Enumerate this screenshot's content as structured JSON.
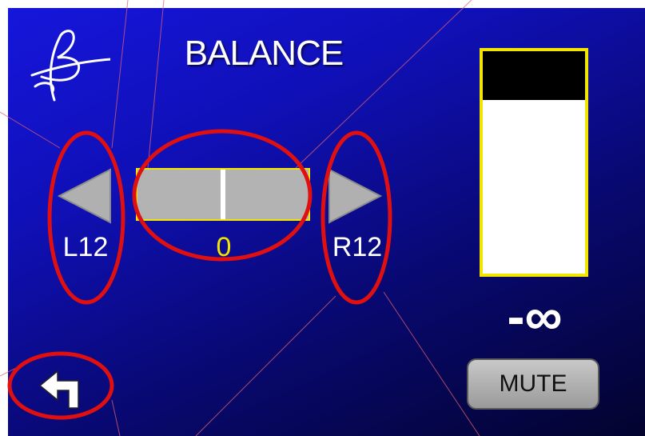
{
  "screen": {
    "title": "BALANCE"
  },
  "balance": {
    "value": "0",
    "left_label": "L12",
    "right_label": "R12",
    "position": 0.5
  },
  "level_meter": {
    "value": "-∞",
    "fill_fraction": 0.22
  },
  "buttons": {
    "mute_label": "MUTE",
    "left_arrow_icon": "left-triangle-icon",
    "right_arrow_icon": "right-triangle-icon",
    "back_icon": "back-arrow-icon"
  },
  "colors": {
    "accent": "#f2e600",
    "annotation": "#e01010",
    "background": "#1010b8"
  }
}
